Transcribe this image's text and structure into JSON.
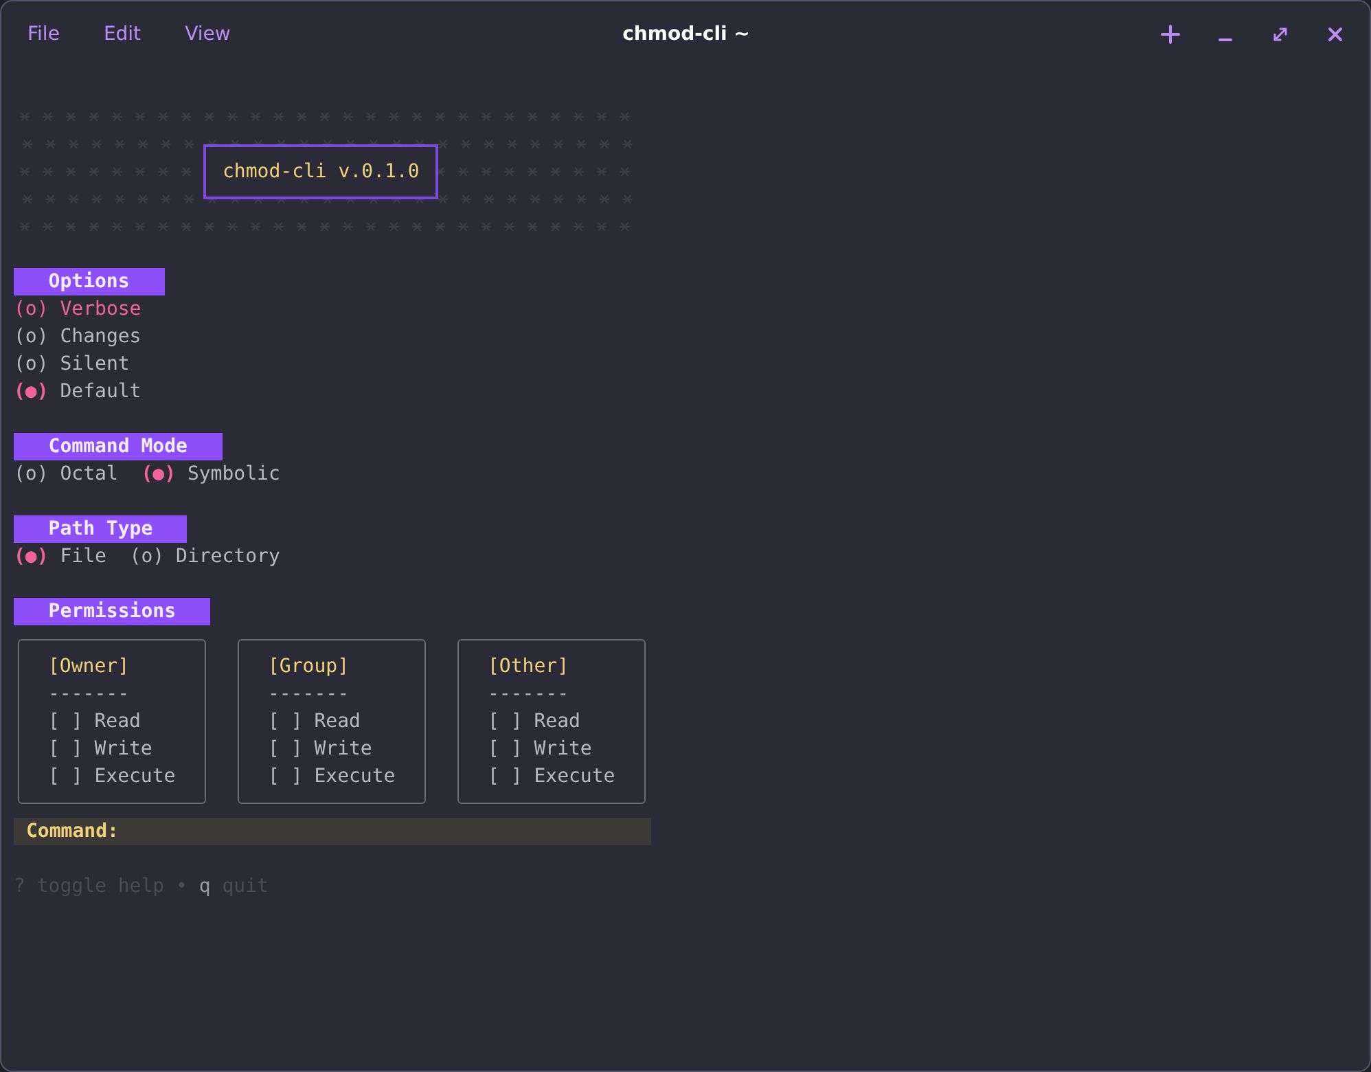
{
  "menu": [
    {
      "label": "File"
    },
    {
      "label": "Edit"
    },
    {
      "label": "View"
    }
  ],
  "window": {
    "title": "chmod-cli ~"
  },
  "banner": {
    "title": "chmod-cli v.0.1.0"
  },
  "sections": [
    {
      "title": "Options",
      "kind": "radio_column",
      "items": [
        {
          "marker": "(o)",
          "label": "Verbose",
          "selected": false,
          "focused": true
        },
        {
          "marker": "(o)",
          "label": "Changes",
          "selected": false,
          "focused": false
        },
        {
          "marker": "(o)",
          "label": "Silent",
          "selected": false,
          "focused": false
        },
        {
          "marker": "(●)",
          "label": "Default",
          "selected": true,
          "focused": false
        }
      ]
    },
    {
      "title": "Command Mode",
      "kind": "radio_row",
      "items": [
        {
          "marker": "(o)",
          "label": "Octal",
          "selected": false,
          "focused": false
        },
        {
          "marker": "(●)",
          "label": "Symbolic",
          "selected": true,
          "focused": false
        }
      ]
    },
    {
      "title": "Path Type",
      "kind": "radio_row",
      "items": [
        {
          "marker": "(●)",
          "label": "File",
          "selected": true,
          "focused": false
        },
        {
          "marker": "(o)",
          "label": "Directory",
          "selected": false,
          "focused": false
        }
      ]
    },
    {
      "title": "Permissions",
      "kind": "checkbox_groups",
      "groups": [
        {
          "title": "[Owner]",
          "rule": "-------",
          "items": [
            {
              "box": "[ ]",
              "label": "Read",
              "checked": false
            },
            {
              "box": "[ ]",
              "label": "Write",
              "checked": false
            },
            {
              "box": "[ ]",
              "label": "Execute",
              "checked": false
            }
          ]
        },
        {
          "title": "[Group]",
          "rule": "-------",
          "items": [
            {
              "box": "[ ]",
              "label": "Read",
              "checked": false
            },
            {
              "box": "[ ]",
              "label": "Write",
              "checked": false
            },
            {
              "box": "[ ]",
              "label": "Execute",
              "checked": false
            }
          ]
        },
        {
          "title": "[Other]",
          "rule": "-------",
          "items": [
            {
              "box": "[ ]",
              "label": "Read",
              "checked": false
            },
            {
              "box": "[ ]",
              "label": "Write",
              "checked": false
            },
            {
              "box": "[ ]",
              "label": "Execute",
              "checked": false
            }
          ]
        }
      ]
    }
  ],
  "command": {
    "label": "Command:"
  },
  "help": [
    {
      "text": "?",
      "bright": false
    },
    {
      "text": "toggle help",
      "bright": false
    },
    {
      "text": "•",
      "bright": false
    },
    {
      "text": "q",
      "bright": true
    },
    {
      "text": "quit",
      "bright": false
    }
  ]
}
